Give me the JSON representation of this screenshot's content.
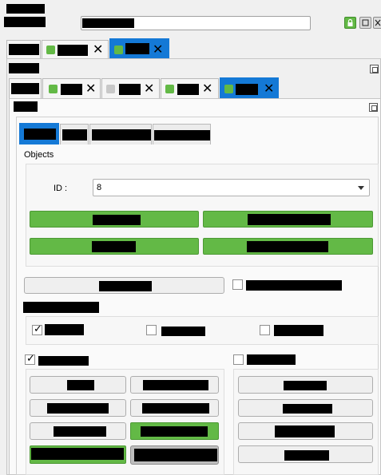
{
  "properties": {
    "objects_label": "Objects",
    "id_label": "ID :",
    "id_value": "8"
  },
  "colors": {
    "accent_green": "#63b946",
    "active_tab_blue": "#1479d6",
    "panel_bg": "#fafafa"
  },
  "icons": {
    "lock": "lock-icon",
    "window": "window-icon",
    "close": "close-icon",
    "detach": "detach-icon",
    "dropdown": "chevron-down-icon"
  }
}
